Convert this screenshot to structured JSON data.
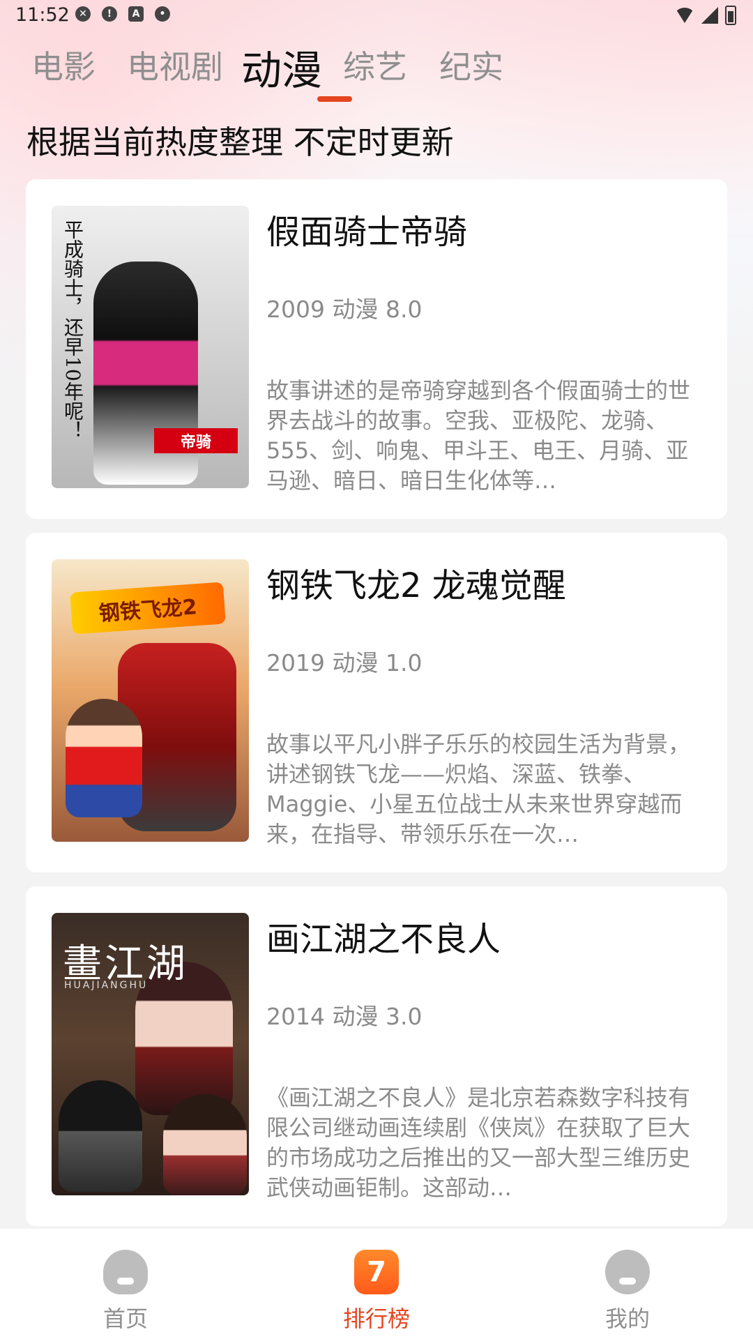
{
  "status_bar": {
    "time": "11:52",
    "left_icons": [
      "close-circle-icon",
      "alert-circle-icon",
      "a-square-icon",
      "shield-icon"
    ],
    "right_icons": [
      "wifi-icon",
      "signal-icon",
      "battery-icon"
    ]
  },
  "tabs": [
    {
      "label": "电影",
      "active": false
    },
    {
      "label": "电视剧",
      "active": false
    },
    {
      "label": "动漫",
      "active": true
    },
    {
      "label": "综艺",
      "active": false
    },
    {
      "label": "纪实",
      "active": false
    }
  ],
  "subtitle": "根据当前热度整理  不定时更新",
  "items": [
    {
      "title": "假面骑士帝骑",
      "meta": "2009 动漫 8.0",
      "description": "故事讲述的是帝骑穿越到各个假面骑士的世界去战斗的故事。空我、亚极陀、龙骑、555、剑、响鬼、甲斗王、电王、月骑、亚马逊、暗日、暗日生化体等…",
      "poster_text": "平成骑士，还早10年呢！",
      "poster_logo": "帝骑"
    },
    {
      "title": "钢铁飞龙2 龙魂觉醒",
      "meta": "2019 动漫 1.0",
      "description": "故事以平凡小胖子乐乐的校园生活为背景，讲述钢铁飞龙——炽焰、深蓝、铁拳、Maggie、小星五位战士从未来世界穿越而来，在指导、带领乐乐在一次…",
      "poster_title": "钢铁飞龙2"
    },
    {
      "title": "画江湖之不良人",
      "meta": "2014 动漫 3.0",
      "description": "《画江湖之不良人》是北京若森数字科技有限公司继动画连续剧《侠岚》在获取了巨大的市场成功之后推出的又一部大型三维历史武侠动画钜制。这部动…",
      "poster_title": "畫江湖",
      "poster_sub": "HUAJIANGHU"
    }
  ],
  "bottom_nav": [
    {
      "label": "首页",
      "icon": "home-icon",
      "active": false
    },
    {
      "label": "排行榜",
      "icon": "rank-icon",
      "active": true,
      "badge": "7"
    },
    {
      "label": "我的",
      "icon": "profile-icon",
      "active": false
    }
  ],
  "colors": {
    "accent": "#e5451f",
    "inactive": "#8f8f8f",
    "background": "#f3f3f3"
  }
}
